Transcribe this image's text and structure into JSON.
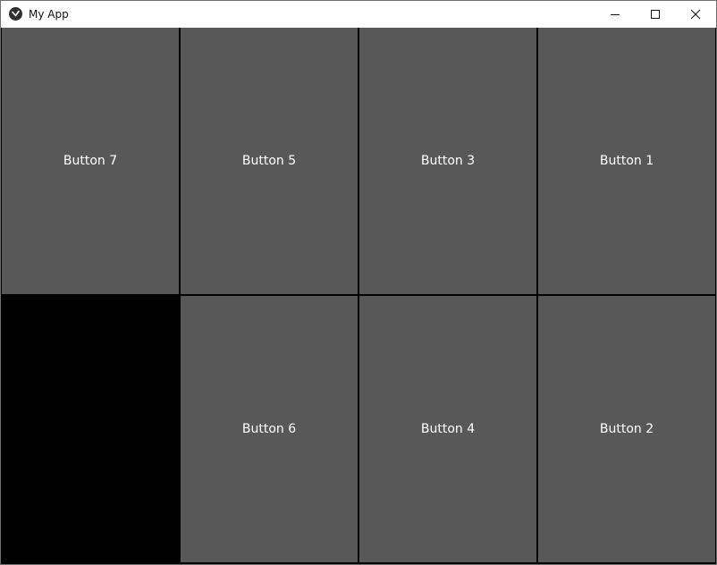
{
  "window": {
    "title": "My App",
    "icon": "kivy-app-icon",
    "controls": [
      "minimize-icon",
      "maximize-icon",
      "close-icon"
    ]
  },
  "grid": {
    "button_color": "#585858",
    "background": "#000000",
    "text_color": "#ffffff",
    "buttons": [
      {
        "label": "Button 7"
      },
      {
        "label": "Button 5"
      },
      {
        "label": "Button 3"
      },
      {
        "label": "Button 1"
      },
      {
        "label": "Button 6"
      },
      {
        "label": "Button 4"
      },
      {
        "label": "Button 2"
      }
    ]
  }
}
